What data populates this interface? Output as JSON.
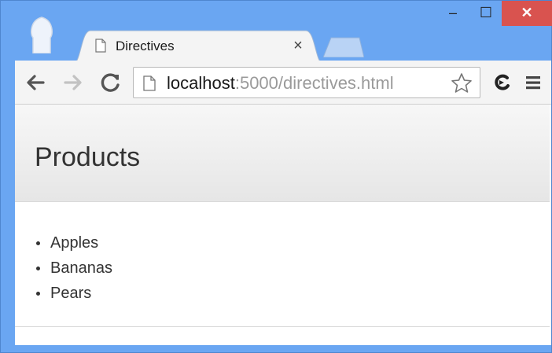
{
  "browser": {
    "tab": {
      "title": "Directives",
      "close_glyph": "×"
    },
    "window_buttons": {
      "minimize": "–",
      "maximize": "☐",
      "close": "✕"
    },
    "toolbar": {
      "back_icon": "back-arrow-icon",
      "forward_icon": "forward-arrow-icon",
      "reload_icon": "reload-icon",
      "url_host": "localhost",
      "url_rest": ":5000/directives.html",
      "bookmark_icon": "star-icon",
      "extension_icon": "extension-icon",
      "menu_icon": "hamburger-menu-icon"
    }
  },
  "page": {
    "title": "Products",
    "items": [
      "Apples",
      "Bananas",
      "Pears"
    ]
  },
  "colors": {
    "frame": "#6aa6f2",
    "close_button": "#d9534f",
    "toolbar": "#f4f4f4"
  }
}
